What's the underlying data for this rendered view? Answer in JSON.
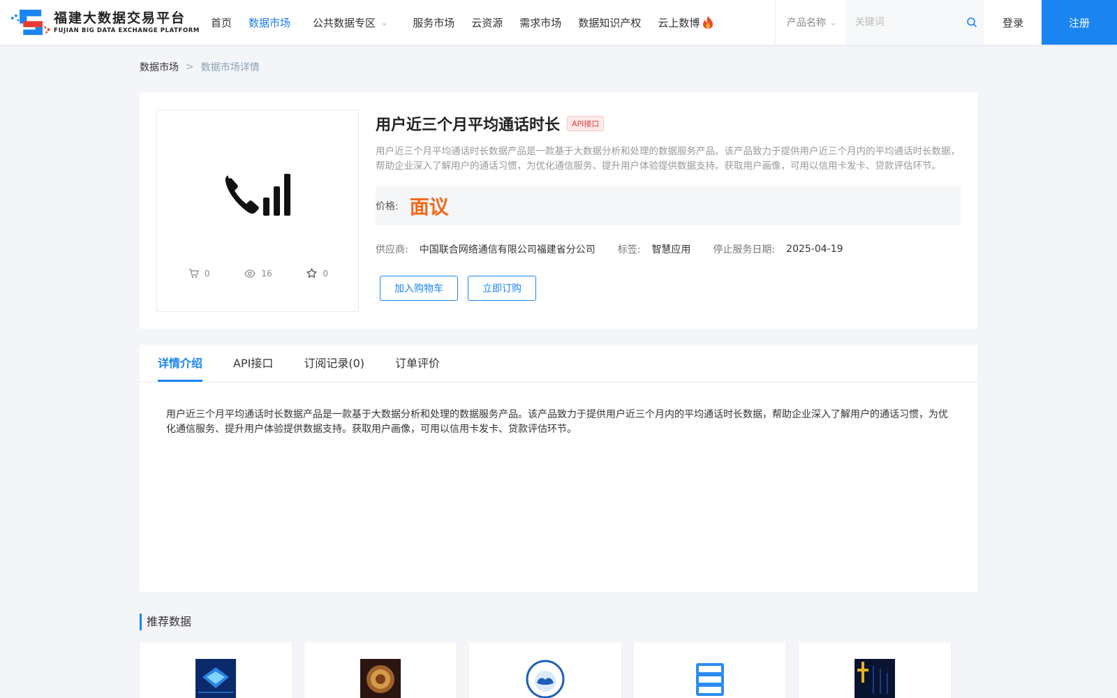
{
  "brand": {
    "name_cn": "福建大数据交易平台",
    "name_en": "FUJIAN BIG DATA EXCHANGE  PLATFORM"
  },
  "nav": {
    "items": [
      {
        "label": "首页"
      },
      {
        "label": "数据市场"
      },
      {
        "label": "公共数据专区"
      },
      {
        "label": "服务市场"
      },
      {
        "label": "云资源"
      },
      {
        "label": "需求市场"
      },
      {
        "label": "数据知识产权"
      },
      {
        "label": "云上数博"
      }
    ]
  },
  "search": {
    "category": "产品名称",
    "placeholder": "关键词",
    "value": ""
  },
  "auth": {
    "login": "登录",
    "register": "注册"
  },
  "breadcrumb": {
    "parent": "数据市场",
    "separator": ">",
    "current": "数据市场详情"
  },
  "product": {
    "title": "用户近三个月平均通话时长",
    "badge": "API接口",
    "description": "用户近三个月平均通话时长数据产品是一款基于大数据分析和处理的数据服务产品。该产品致力于提供用户近三个月内的平均通话时长数据，帮助企业深入了解用户的通话习惯，为优化通信服务、提升用户体验提供数据支持。获取用户画像，可用以信用卡发卡、贷款评估环节。",
    "price_label": "价格:",
    "price": "面议",
    "stats": {
      "cart": "0",
      "views": "16",
      "favorites": "0"
    },
    "supplier_label": "供应商:",
    "supplier": "中国联合网络通信有限公司福建省分公司",
    "tag_label": "标签:",
    "tag": "智慧应用",
    "end_date_label": "停止服务日期:",
    "end_date": "2025-04-19",
    "add_to_cart": "加入购物车",
    "subscribe": "立即订购"
  },
  "tabs": [
    {
      "label": "详情介绍"
    },
    {
      "label": "API接口"
    },
    {
      "label": "订阅记录(0)"
    },
    {
      "label": "订单评价"
    }
  ],
  "detail_text": "用户近三个月平均通话时长数据产品是一款基于大数据分析和处理的数据服务产品。该产品致力于提供用户近三个月内的平均通话时长数据，帮助企业深入了解用户的通话习惯，为优化通信服务、提升用户体验提供数据支持。获取用户画像，可用以信用卡发卡、贷款评估环节。",
  "recommended": {
    "title": "推荐数据"
  },
  "colors": {
    "accent": "#1a85f0",
    "price": "#f26a1b",
    "badge": "#e63a3a"
  }
}
